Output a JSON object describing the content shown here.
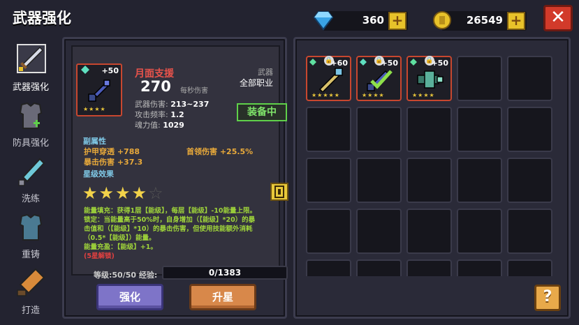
{
  "header": {
    "title": "武器强化",
    "gems": "360",
    "coins": "26549",
    "close_label": "✕"
  },
  "sidebar": {
    "items": [
      {
        "label": "武器强化"
      },
      {
        "label": "防具强化"
      },
      {
        "label": "洗练"
      },
      {
        "label": "重铸"
      },
      {
        "label": "打造"
      }
    ]
  },
  "weapon": {
    "level_badge": "+50",
    "name": "月面支援",
    "dps": "270",
    "dps_label": "每秒伤害",
    "damage": "武器伤害: ",
    "damage_val": "213~237",
    "rate": "攻击频率: ",
    "rate_val": "1.2",
    "soul": "魂力值: ",
    "soul_val": "1029",
    "type": "武器",
    "class": "全部职业",
    "equip_label": "装备中",
    "stars_small": "★★★★"
  },
  "attributes": {
    "section": "副属性",
    "a1": "护甲穿透 +788",
    "a2": "首领伤害 +25.5%",
    "a3": "暴击伤害 +37.3"
  },
  "star_effect": {
    "section": "星级效果",
    "stars_on": "★★★★",
    "stars_off": "☆",
    "line1": "能量填充：获得1层【能级】，每层【能级】-10能量上限。",
    "line2": "锁定：当能量高于50%时，自身增加（【能级】*20）的暴",
    "line3": "击值和（【能级】*10）的暴击伤害，但使用技能额外消耗",
    "line4": "（0.5*【能级】）能量。",
    "line5": "能量充盈：【能级】+1。",
    "line6": "(5星解锁)"
  },
  "progress": {
    "level_text": "等级:50/50",
    "exp_label": "经验:",
    "exp_value": "0/1383"
  },
  "buttons": {
    "upgrade": "强化",
    "star_up": "升星",
    "help": "?"
  },
  "inventory": [
    {
      "level": "+60",
      "stars": "★★★★★"
    },
    {
      "level": "+50",
      "stars": "★★★★"
    },
    {
      "level": "+50",
      "stars": "★★★★"
    }
  ],
  "colors": {
    "accent_red": "#c8472f",
    "equip_green": "#5fd04a",
    "skill_green": "#9fd43a",
    "attr_orange": "#e8a93a",
    "section_blue": "#7fc8e6"
  }
}
